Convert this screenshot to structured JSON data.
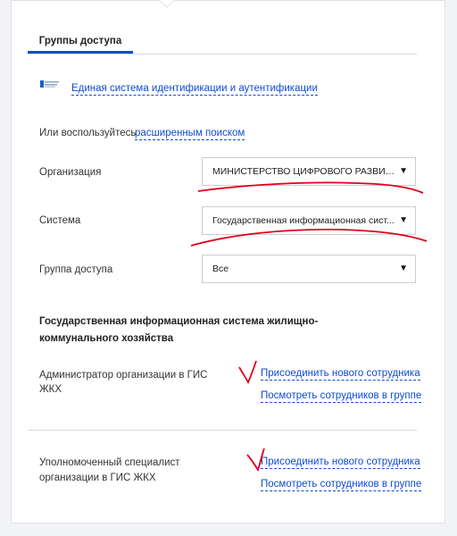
{
  "tab": {
    "label": "Группы доступа"
  },
  "esia": {
    "link": "Единая система идентификации и аутентификации",
    "logo": "esia-logo"
  },
  "search": {
    "prefix": "Или воспользуйтесь",
    "link": "расширенным поиском"
  },
  "filters": {
    "organization": {
      "label": "Организация",
      "value": "МИНИСТЕРСТВО ЦИФРОВОГО РАЗВИТ..."
    },
    "system": {
      "label": "Система",
      "value": "Государственная информационная сист..."
    },
    "group": {
      "label": "Группа доступа",
      "value": "Все"
    }
  },
  "section": {
    "title": "Государственная информационная система жилищно-коммунального хозяйства",
    "roles": [
      {
        "name_line1": "Администратор организации в ГИС",
        "name_line2": "ЖКХ",
        "join": "Присоединить нового сотрудника",
        "view": "Посмотреть сотрудников в группе"
      },
      {
        "name_line1": "Уполномоченный специалист",
        "name_line2": "организации в ГИС ЖКХ",
        "join": "Присоединить нового сотрудника",
        "view": "Посмотреть сотрудников в группе"
      }
    ]
  },
  "colors": {
    "accent": "#0d4cd3",
    "annotation": "#e0001b"
  }
}
